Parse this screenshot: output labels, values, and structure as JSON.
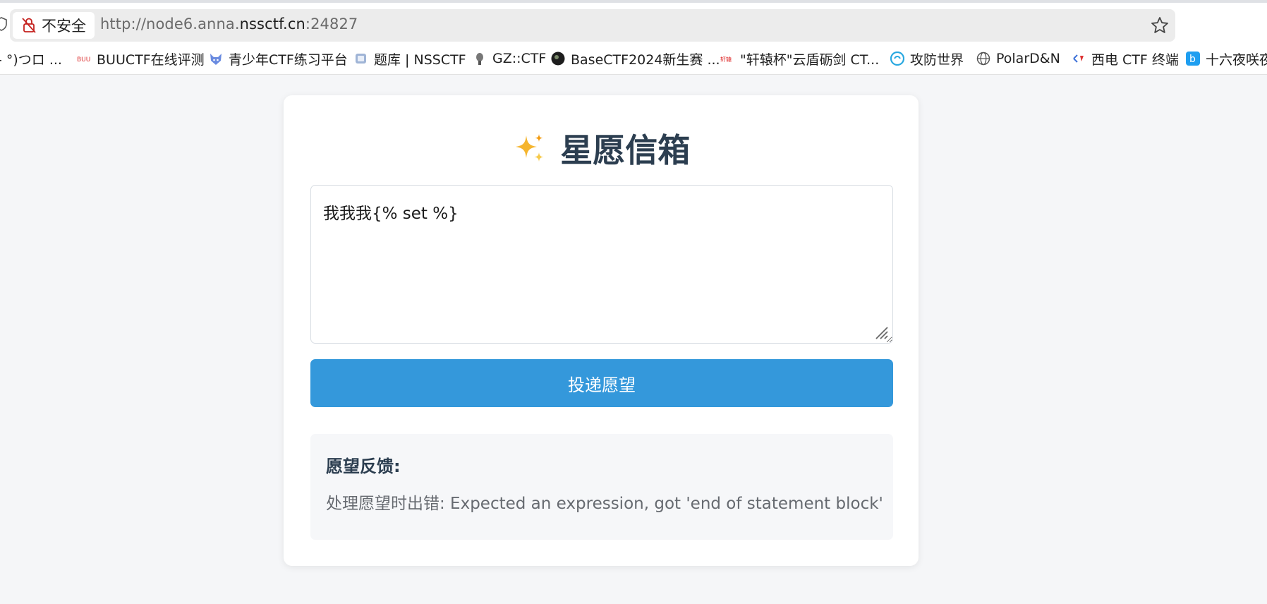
{
  "browser": {
    "security_label": "不安全",
    "url_scheme_prefix": "http://node6.anna.",
    "url_host": "nssctf.cn",
    "url_port": ":24827",
    "icons": [
      "shield-icon",
      "not-secure-lock-icon",
      "star-icon"
    ]
  },
  "bookmarks": [
    {
      "label": "- °)つロ ...",
      "icon": "none"
    },
    {
      "label": "BUUCTF在线评测",
      "icon": "buuctf-icon"
    },
    {
      "label": "青少年CTF练习平台",
      "icon": "fox-icon"
    },
    {
      "label": "题库 | NSSCTF",
      "icon": "nssctf-icon"
    },
    {
      "label": "GZ::CTF",
      "icon": "gzctf-icon"
    },
    {
      "label": "BaseCTF2024新生赛 ...",
      "icon": "basectf-icon"
    },
    {
      "label": "\"轩辕杯\"云盾砺剑 CT...",
      "icon": "xuanyuan-icon"
    },
    {
      "label": "攻防世界",
      "icon": "adworld-icon"
    },
    {
      "label": "PolarD&N",
      "icon": "globe-icon"
    },
    {
      "label": "西电 CTF 终端",
      "icon": "xidian-icon"
    },
    {
      "label": "十六夜咲夜",
      "icon": "b-icon"
    }
  ],
  "page": {
    "title": "星愿信箱",
    "title_icon": "sparkles-icon",
    "textarea_value": "我我我{% set %}",
    "submit_label": "投递愿望",
    "feedback_title": "愿望反馈:",
    "feedback_message": "处理愿望时出错: Expected an expression, got 'end of statement block'"
  },
  "colors": {
    "accent": "#3498db",
    "title": "#2c3e50",
    "page_bg": "#f5f6f8",
    "feedback_bg": "#f6f7f9"
  }
}
